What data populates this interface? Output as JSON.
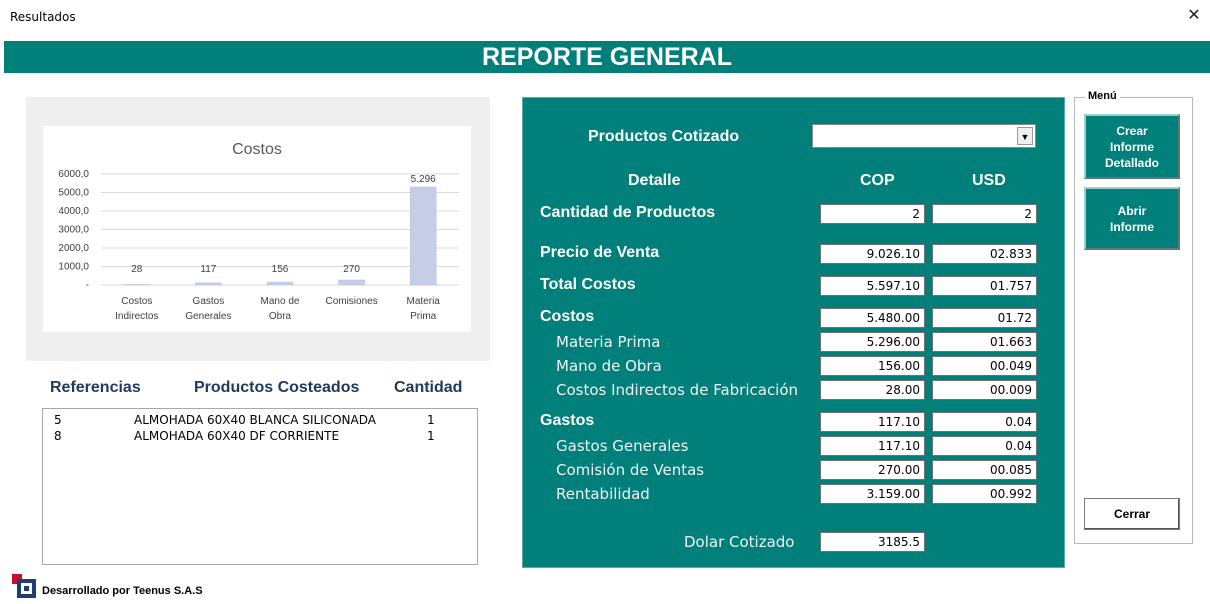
{
  "window": {
    "title": "Resultados",
    "close_glyph": "✕"
  },
  "banner": {
    "title": "REPORTE GENERAL"
  },
  "chart_data": {
    "type": "bar",
    "title": "Costos",
    "categories": [
      [
        "Costos",
        "Indirectos"
      ],
      [
        "Gastos",
        "Generales"
      ],
      [
        "Mano de",
        "Obra"
      ],
      [
        "Comisiones"
      ],
      [
        "Materia",
        "Prima"
      ]
    ],
    "values": [
      28,
      117,
      156,
      270,
      5296
    ],
    "data_labels": [
      "28",
      "117",
      "156",
      "270",
      "5.296"
    ],
    "y_ticks": [
      "-",
      "1000,0",
      "2000,0",
      "3000,0",
      "4000,0",
      "5000,0",
      "6000,0"
    ],
    "ylim": [
      0,
      6000
    ],
    "grid": true,
    "bar_color": "#c6cde6"
  },
  "list": {
    "headers": {
      "references": "Referencias",
      "products": "Productos Costeados",
      "quantity": "Cantidad"
    },
    "rows": [
      {
        "ref": "5",
        "product": "ALMOHADA 60X40 BLANCA SILICONADA",
        "qty": "1"
      },
      {
        "ref": "8",
        "product": "ALMOHADA 60X40 DF CORRIENTE",
        "qty": "1"
      }
    ]
  },
  "report": {
    "products_label": "Productos  Cotizado",
    "dropdown_value": "",
    "detail_header": "Detalle",
    "cop_header": "COP",
    "usd_header": "USD",
    "rows": [
      {
        "label": "Cantidad de Productos",
        "cop": "2",
        "usd": "2"
      },
      {
        "label": "Precio de Venta",
        "cop": "9.026.10",
        "usd": "02.833"
      },
      {
        "label": "Total Costos",
        "cop": "5.597.10",
        "usd": "01.757"
      },
      {
        "label": "Costos",
        "cop": "5.480.00",
        "usd": "01.72"
      },
      {
        "label": "Materia Prima",
        "cop": "5.296.00",
        "usd": "01.663"
      },
      {
        "label": "Mano de Obra",
        "cop": "156.00",
        "usd": "00.049"
      },
      {
        "label": "Costos Indirectos de Fabricación",
        "cop": "28.00",
        "usd": "00.009"
      },
      {
        "label": "Gastos",
        "cop": "117.10",
        "usd": "0.04"
      },
      {
        "label": "Gastos Generales",
        "cop": "117.10",
        "usd": "0.04"
      },
      {
        "label": "Comisión de Ventas",
        "cop": "270.00",
        "usd": "00.085"
      },
      {
        "label": "Rentabilidad",
        "cop": "3.159.00",
        "usd": "00.992"
      }
    ],
    "dollar_label": "Dolar Cotizado",
    "dollar_value": "3185.5"
  },
  "menu": {
    "legend": "Menú",
    "create_report": "Crear Informe Detallado",
    "open_report": "Abrir Informe",
    "close": "Cerrar"
  },
  "footer": {
    "text": "Desarrollado por Teenus S.A.S"
  },
  "colors": {
    "accent": "#007f7b",
    "heading": "#1d3a5c"
  }
}
